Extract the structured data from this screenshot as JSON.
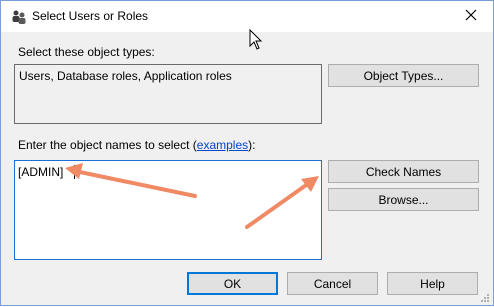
{
  "window": {
    "title": "Select Users or Roles",
    "close_glyph": "✕"
  },
  "object_types": {
    "label": "Select these object types:",
    "value": "Users, Database roles, Application roles",
    "button_label": "Object Types..."
  },
  "object_names": {
    "label_prefix": "Enter the object names to select (",
    "link_text": "examples",
    "label_suffix": "):",
    "value": "[ADMIN]",
    "check_names_label": "Check Names",
    "browse_label": "Browse..."
  },
  "footer": {
    "ok_label": "OK",
    "cancel_label": "Cancel",
    "help_label": "Help"
  },
  "annotations": {
    "arrow_color": "#f08a64"
  },
  "colors": {
    "accent": "#0078d7",
    "link": "#0044cc"
  }
}
